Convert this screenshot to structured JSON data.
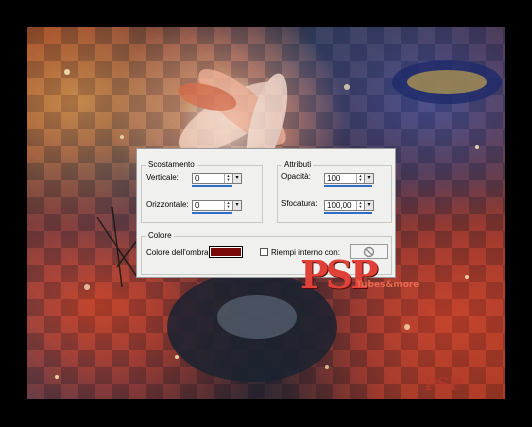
{
  "dialog": {
    "offset_group": {
      "title": "Scostamento",
      "vertical": {
        "label": "Verticale:",
        "value": "0"
      },
      "horizontal": {
        "label": "Orizzontale:",
        "value": "0"
      }
    },
    "attributes_group": {
      "title": "Attributi",
      "opacity": {
        "label": "Opacità:",
        "value": "100"
      },
      "blur": {
        "label": "Sfocatura:",
        "value": "100,00"
      }
    },
    "color_group": {
      "title": "Colore",
      "shadow_color_label": "Colore dell'ombra:",
      "shadow_color": "#7a0a0a",
      "fill_inside_label": "Riempi interno con:",
      "fill_inside_checked": false
    }
  },
  "watermark": {
    "logo_text": "PSP",
    "tag_text": "Tubes&more",
    "corner_logo": "PSP"
  },
  "icons": {
    "spin_up": "▲",
    "spin_down": "▼",
    "dropdown": "▾",
    "no_fill": "no-symbol-icon"
  }
}
